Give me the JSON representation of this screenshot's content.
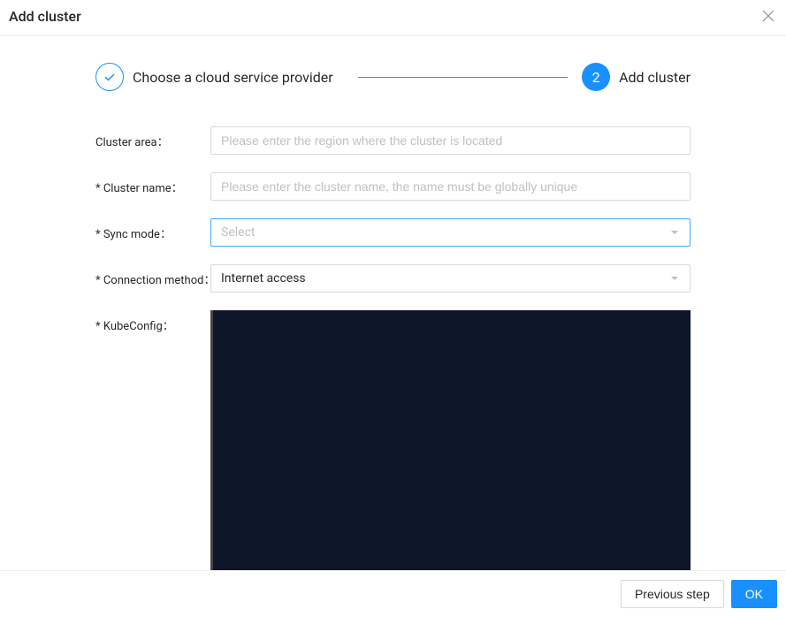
{
  "header": {
    "title": "Add cluster"
  },
  "stepper": {
    "step1": {
      "label": "Choose a cloud service provider",
      "state": "done"
    },
    "step2": {
      "label": "Add cluster",
      "number": "2",
      "state": "active"
    }
  },
  "form": {
    "cluster_area": {
      "label": "Cluster area",
      "placeholder": "Please enter the region where the cluster is located",
      "value": "",
      "required": false
    },
    "cluster_name": {
      "label": "Cluster name",
      "placeholder": "Please enter the cluster name, the name must be globally unique",
      "value": "",
      "required": true
    },
    "sync_mode": {
      "label": "Sync mode",
      "placeholder": "Select",
      "value": "",
      "required": true
    },
    "connection_method": {
      "label": "Connection method",
      "value": "Internet access",
      "required": true
    },
    "kubeconfig": {
      "label": "KubeConfig",
      "value": "",
      "required": true
    }
  },
  "footer": {
    "prev_label": "Previous step",
    "ok_label": "OK"
  }
}
